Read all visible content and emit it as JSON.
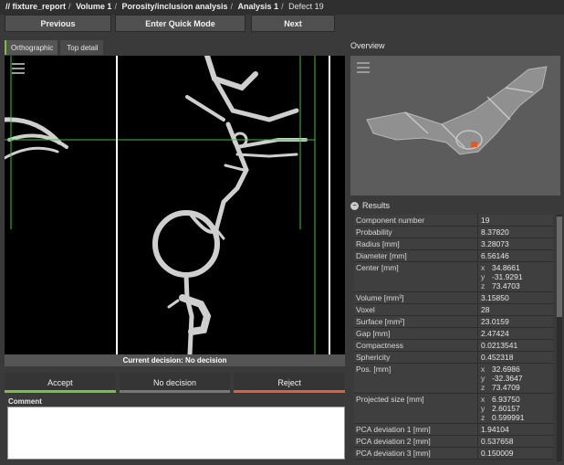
{
  "breadcrumb": {
    "items": [
      "fixture_report",
      "Volume 1",
      "Porosity/inclusion analysis",
      "Analysis 1"
    ],
    "prefix": "//",
    "separator": "/",
    "current": "Defect 19"
  },
  "nav": {
    "previous": "Previous",
    "quick_mode": "Enter Quick Mode",
    "next": "Next"
  },
  "view_tabs": [
    "Orthographic",
    "Top detail"
  ],
  "decision": {
    "current": "Current decision: No decision",
    "accept": "Accept",
    "no_decision": "No decision",
    "reject": "Reject",
    "comment_label": "Comment",
    "comment_value": ""
  },
  "overview_title": "Overview",
  "results_title": "Results",
  "results": [
    {
      "k": "Component number",
      "v": "19"
    },
    {
      "k": "Probability",
      "v": "8.37820"
    },
    {
      "k": "Radius [mm]",
      "v": "3.28073"
    },
    {
      "k": "Diameter [mm]",
      "v": "6.56146"
    },
    {
      "k": "Center [mm]",
      "x": "34.8661",
      "y": "-31.9291",
      "z": "73.4703"
    },
    {
      "k": "Volume [mm³]",
      "v": "3.15850"
    },
    {
      "k": "Voxel",
      "v": "28"
    },
    {
      "k": "Surface [mm²]",
      "v": "23.0159"
    },
    {
      "k": "Gap [mm]",
      "v": "2.47424"
    },
    {
      "k": "Compactness",
      "v": "0.0213541"
    },
    {
      "k": "Sphericity",
      "v": "0.452318"
    },
    {
      "k": "Pos. [mm]",
      "x": "32.6986",
      "y": "-32.3647",
      "z": "73.4709"
    },
    {
      "k": "Projected size [mm]",
      "x": "6.93750",
      "y": "2.60157",
      "z": "0.599991"
    },
    {
      "k": "PCA deviation 1 [mm]",
      "v": "1.94104"
    },
    {
      "k": "PCA deviation 2 [mm]",
      "v": "0.537658"
    },
    {
      "k": "PCA deviation 3 [mm]",
      "v": "0.150009"
    }
  ],
  "colors": {
    "accept": "#7ac143",
    "reject": "#e0603a",
    "crosshair": "#3fbf3f"
  }
}
